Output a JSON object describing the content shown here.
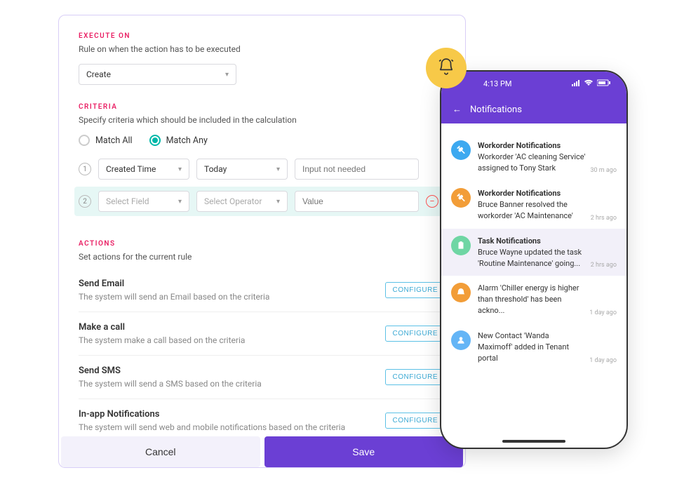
{
  "colors": {
    "accent": "#6b3fd4",
    "pink": "#e91e63",
    "teal": "#00b8a9",
    "yellow": "#f7c948"
  },
  "execute": {
    "label": "EXECUTE ON",
    "desc": "Rule on when the action has to be executed",
    "select_value": "Create"
  },
  "criteria": {
    "label": "CRITERIA",
    "desc": "Specify criteria which should be included in the calculation",
    "match_all": "Match All",
    "match_any": "Match Any",
    "selected": "any",
    "rows": [
      {
        "num": "1",
        "field": "Created Time",
        "op": "Today",
        "val_placeholder": "Input not needed",
        "field_is_placeholder": false,
        "op_is_placeholder": false
      },
      {
        "num": "2",
        "field": "Select Field",
        "op": "Select Operator",
        "val_placeholder": "Value",
        "field_is_placeholder": true,
        "op_is_placeholder": true
      }
    ]
  },
  "actions": {
    "label": "ACTIONS",
    "desc": "Set actions for the current rule",
    "configure_label": "CONFIGURE",
    "items": [
      {
        "title": "Send Email",
        "desc": "The system will send an Email based on the criteria"
      },
      {
        "title": "Make a call",
        "desc": "The system make a call based on the criteria"
      },
      {
        "title": "Send SMS",
        "desc": "The system will send a SMS based on the criteria"
      },
      {
        "title": "In-app Notifications",
        "desc": "The system will send web and mobile notifications based on the criteria"
      }
    ]
  },
  "footer": {
    "cancel": "Cancel",
    "save": "Save"
  },
  "phone": {
    "time": "4:13 PM",
    "header_title": "Notifications",
    "signal_icon": "signal",
    "wifi_icon": "wifi",
    "battery_icon": "battery",
    "notif": [
      {
        "icon": "tools",
        "color": "#3da9f0",
        "title": "Workorder Notifications",
        "body": "Workorder 'AC cleaning Service' assigned to Tony Stark",
        "ts": "30 m ago",
        "highlighted": false
      },
      {
        "icon": "tools",
        "color": "#f29d38",
        "title": "Workorder Notifications",
        "body": "Bruce Banner resolved the workorder 'AC Maintenance'",
        "ts": "2 hrs ago",
        "highlighted": false
      },
      {
        "icon": "clipboard",
        "color": "#6fd6a4",
        "title": "Task Notifications",
        "body": "Bruce Wayne updated the task 'Routine Maintenance' going...",
        "ts": "2 hrs ago",
        "highlighted": true
      },
      {
        "icon": "alarm",
        "color": "#f29d38",
        "title": "",
        "body": "Alarm 'Chiller energy is higher than threshold' has been ackno...",
        "ts": "1 day ago",
        "highlighted": false
      },
      {
        "icon": "user",
        "color": "#64b5f6",
        "title": "",
        "body": "New Contact 'Wanda Maximoff' added in Tenant portal",
        "ts": "1 day ago",
        "highlighted": false
      }
    ]
  }
}
